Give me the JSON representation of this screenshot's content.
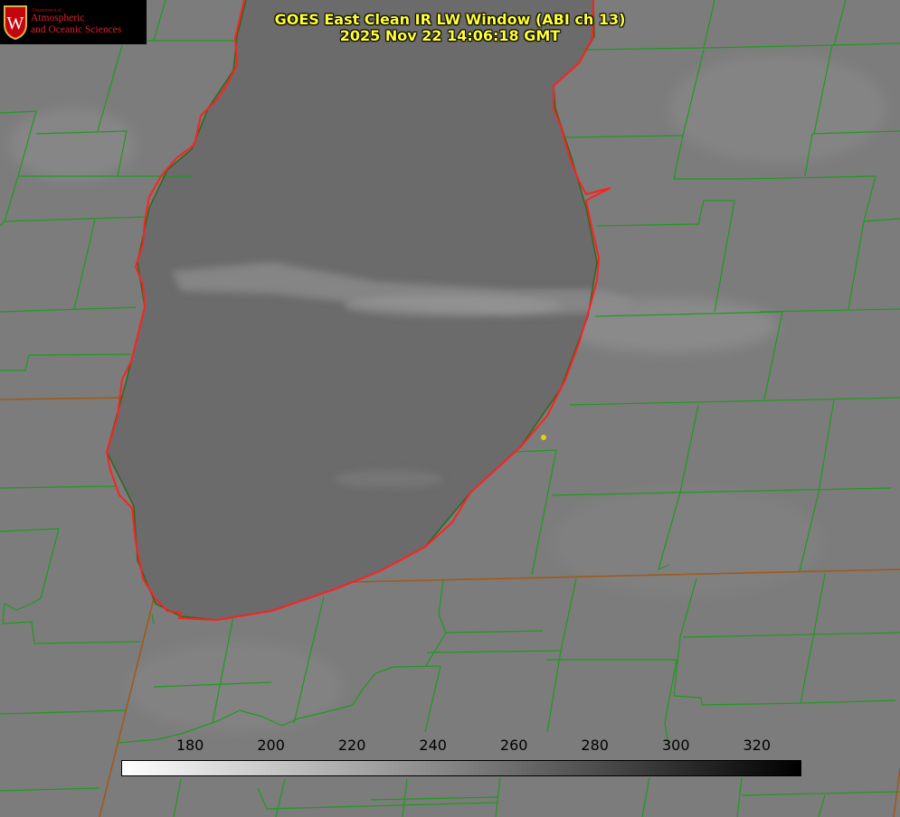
{
  "title": {
    "line1": "GOES East Clean IR LW Window (ABI ch 13)",
    "line2": "2025 Nov 22 14:06:18 GMT"
  },
  "logo": {
    "dept": "Department of",
    "line1": "Atmospheric",
    "line2": "and Oceanic Sciences",
    "seal_letter": "W"
  },
  "colorbar": {
    "ticks": [
      "180",
      "200",
      "220",
      "240",
      "260",
      "280",
      "300",
      "320"
    ],
    "tick_values": [
      180,
      200,
      220,
      240,
      260,
      280,
      300,
      320
    ],
    "min": 163,
    "max": 331,
    "colors": {
      "low": "#ffffff",
      "high": "#000000"
    }
  },
  "map": {
    "colors": {
      "background": "#7c7c7c",
      "lake": "#6b6b6b",
      "county_lines": "#1e9a1e",
      "state_lines": "#9a5a1a",
      "shoreline": "#ff2020",
      "marker": "#e6d000"
    },
    "marker_label": ""
  }
}
